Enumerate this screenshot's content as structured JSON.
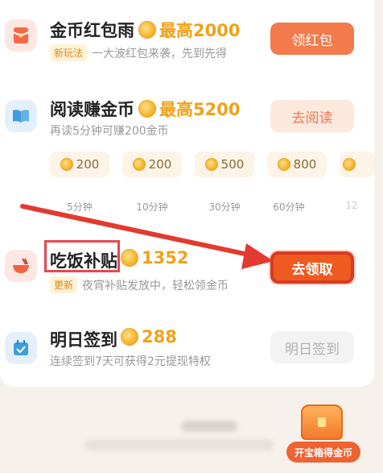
{
  "tasks": [
    {
      "title": "金币红包雨",
      "reward": "最高2000",
      "tag": "新玩法",
      "desc": "一大波红包来袭，先到先得",
      "button": "领红包"
    },
    {
      "title": "阅读赚金币",
      "reward": "最高5200",
      "desc": "再读5分钟可赚200金币",
      "button": "去阅读",
      "steps": [
        {
          "coins": "200",
          "time": "5分钟"
        },
        {
          "coins": "200",
          "time": "10分钟"
        },
        {
          "coins": "500",
          "time": "30分钟"
        },
        {
          "coins": "800",
          "time": "60分钟"
        },
        {
          "coins": "",
          "time": "12"
        }
      ]
    },
    {
      "title": "吃饭补贴",
      "reward": "1352",
      "tag": "更新",
      "desc": "夜宵补贴发放中，轻松领金币",
      "button": "去领取"
    },
    {
      "title": "明日签到",
      "reward": "288",
      "desc": "连续签到7天可获得2元提现特权",
      "button": "明日签到"
    }
  ],
  "chest": {
    "label": "开宝箱得金币"
  },
  "colors": {
    "accent": "#f27a4b",
    "coin": "#f0a21a",
    "highlight": "#e8474f"
  }
}
